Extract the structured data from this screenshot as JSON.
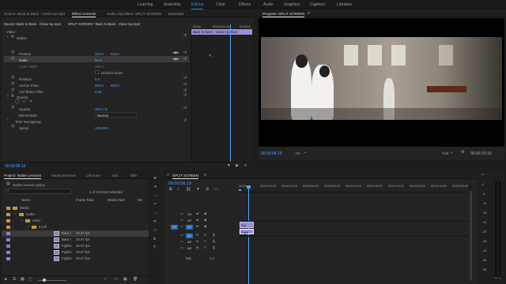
{
  "workspaces": [
    "Learning",
    "Assembly",
    "Editing",
    "Color",
    "Effects",
    "Audio",
    "Graphics",
    "Captions",
    "Libraries"
  ],
  "source_tabs": [
    "Source: Back to Back - Close Up.mp4",
    "Effect Controls",
    "Audio Clip Mixer: SPLIT SCREEN",
    "Metadata"
  ],
  "effect_controls": {
    "header_clip": "SPLIT SCREEN * Back to Back - Close Up.mp4",
    "section_video": "Video",
    "motion": "Motion",
    "position_label": "Position",
    "position_x": "320.0",
    "position_y": "540.0",
    "scale_label": "Scale",
    "scale_val": "50.0",
    "scale_width_label": "Scale Width",
    "scale_width_val": "100.0",
    "uniform_scale": "Uniform Scale",
    "rotation_label": "Rotation",
    "rotation_val": "0.0",
    "anchor_label": "Anchor Point",
    "anchor_x": "960.0",
    "anchor_y": "540.0",
    "antiflicker_label": "Anti-flicker Filter",
    "antiflicker_val": "0.00",
    "opacity": "Opacity",
    "opacity_label": "Opacity",
    "opacity_val": "100.0 %",
    "blend_label": "Blend Mode",
    "blend_val": "Normal",
    "time_remap": "Time Remapping",
    "speed_label": "Speed",
    "speed_val": "100.00%",
    "timecode": "00:00:06:19",
    "mini_tc_start": "00:00",
    "mini_tc_mid": "00:00:04:23",
    "mini_tc_end": "00:00:0",
    "mini_clip": "Back to Back - Close Up.mp4"
  },
  "program": {
    "title": "Program: SPLIT SCREEN",
    "timecode": "00:00:06:19",
    "fit": "Fit",
    "quality": "Full",
    "duration": "00:00:10:10"
  },
  "project": {
    "tabs": [
      "Project: Noble Lessons",
      "Media Browser",
      "Libraries",
      "Info",
      "Effe"
    ],
    "filename": "Noble Lessons.prproj",
    "items_count": "1 of 34 items selected",
    "col_name": "Name",
    "col_rate": "Frame Rate",
    "col_start": "Media Start",
    "col_end": "Me",
    "folders": [
      "Media",
      "audio",
      "video",
      "a-roll"
    ],
    "clips": [
      {
        "name": "Back t",
        "rate": "29.97 fps"
      },
      {
        "name": "Back t",
        "rate": "29.97 fps"
      },
      {
        "name": "Fightin",
        "rate": "29.97 fps"
      },
      {
        "name": "Fightin",
        "rate": "29.97 fps"
      },
      {
        "name": "Fightin",
        "rate": "29.97 fps"
      }
    ]
  },
  "timeline": {
    "tab": "SPLIT SCREEN",
    "timecode": "00:00:06:19",
    "ruler": [
      "00:00",
      "00:00:14:23",
      "00:00:29:23",
      "00:00:44:22",
      "00:00:59:22",
      "00:01:14:22",
      "00:01:29:21",
      "00:01:44:21",
      "00:01:59:21",
      "00:02:14:20",
      "00:02:29:20"
    ],
    "video_tracks": [
      "V3",
      "V2",
      "V1"
    ],
    "audio_tracks": [
      "A1",
      "A2",
      "A3"
    ],
    "mix_label": "Mix",
    "mix_val": "0.0",
    "v1_label": "V1",
    "clip_top": "Fig",
    "clip_bottom": "Fight"
  },
  "meter_labels": [
    "0",
    "-6",
    "-12",
    "-18",
    "-24",
    "-30",
    "-36",
    "-42",
    "-48",
    "-54"
  ],
  "colors": {
    "accent": "#2d8ceb",
    "clip": "#9b8ed6",
    "playhead": "#4ba3ff"
  }
}
